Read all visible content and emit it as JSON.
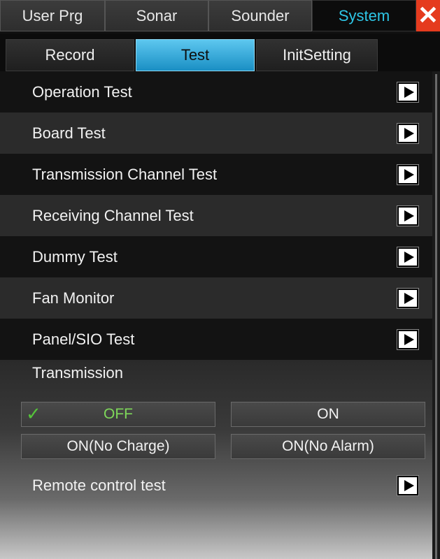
{
  "top_tabs": [
    {
      "label": "User Prg"
    },
    {
      "label": "Sonar"
    },
    {
      "label": "Sounder"
    },
    {
      "label": "System"
    }
  ],
  "close_glyph": "✕",
  "sub_tabs": [
    {
      "label": "Record"
    },
    {
      "label": "Test"
    },
    {
      "label": "InitSetting"
    }
  ],
  "menu": [
    {
      "label": "Operation Test"
    },
    {
      "label": "Board Test"
    },
    {
      "label": "Transmission Channel Test"
    },
    {
      "label": "Receiving Channel Test"
    },
    {
      "label": "Dummy Test"
    },
    {
      "label": "Fan Monitor"
    },
    {
      "label": "Panel/SIO Test"
    }
  ],
  "transmission": {
    "label": "Transmission",
    "options": [
      {
        "label": "OFF",
        "selected": true
      },
      {
        "label": "ON"
      },
      {
        "label": "ON(No Charge)"
      },
      {
        "label": "ON(No Alarm)"
      }
    ],
    "check_glyph": "✓"
  },
  "remote": {
    "label": "Remote control test"
  },
  "colors": {
    "active_tab_text": "#2ec6e6",
    "active_subtab": "#2aa3d8",
    "close": "#e53b1e",
    "selected_text": "#7ed85a"
  }
}
